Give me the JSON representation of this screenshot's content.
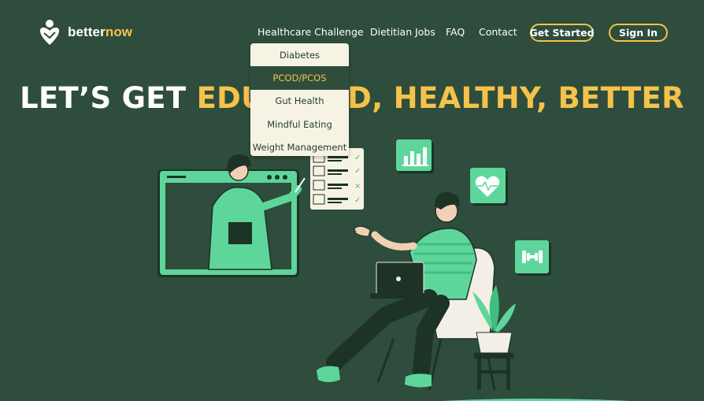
{
  "brand": {
    "name_part1": "better",
    "name_part2": "now"
  },
  "nav": {
    "items": [
      "Healthcare Challenge",
      "Dietitian Jobs",
      "FAQ",
      "Contact"
    ],
    "get_started": "Get  Started",
    "sign_in": "Sign In"
  },
  "dropdown": {
    "items": [
      "Diabetes",
      "PCOD/PCOS",
      "Gut Health",
      "Mindful Eating",
      "Weight Management"
    ],
    "active_index": 1
  },
  "hero": {
    "title_part1": "LET’S GET ",
    "title_part2": "EDUCATED, HEALTHY, BETTER"
  },
  "icons": [
    "bar-chart-icon",
    "heart-pulse-icon",
    "dumbbell-icon",
    "checklist-icon"
  ],
  "colors": {
    "background": "#2e4d3c",
    "accent": "#f5c24b",
    "green": "#5ed69b",
    "dropdown_bg": "#f7f3e4"
  }
}
